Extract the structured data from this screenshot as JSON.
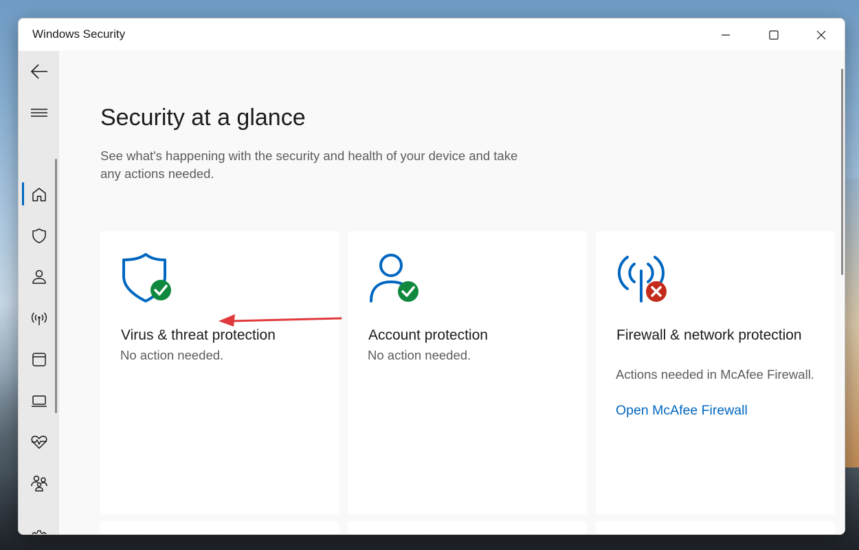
{
  "window": {
    "title": "Windows Security",
    "controls": {
      "minimize": "minimize-icon",
      "maximize": "maximize-icon",
      "close": "close-icon"
    }
  },
  "sidebar": {
    "items": [
      {
        "name": "back",
        "icon": "back-arrow-icon"
      },
      {
        "name": "menu",
        "icon": "hamburger-icon"
      },
      {
        "name": "home",
        "icon": "home-icon",
        "active": true
      },
      {
        "name": "virus-threat-protection",
        "icon": "shield-icon"
      },
      {
        "name": "account-protection",
        "icon": "person-icon"
      },
      {
        "name": "firewall-network",
        "icon": "wireless-icon"
      },
      {
        "name": "app-browser-control",
        "icon": "app-window-icon"
      },
      {
        "name": "device-security",
        "icon": "laptop-icon"
      },
      {
        "name": "device-performance-health",
        "icon": "heart-pulse-icon"
      },
      {
        "name": "family-options",
        "icon": "family-icon"
      },
      {
        "name": "settings",
        "icon": "gear-icon"
      }
    ]
  },
  "main": {
    "title": "Security at a glance",
    "subtitle": "See what's happening with the security and health of your device and take any actions needed.",
    "cards": [
      {
        "title": "Virus & threat protection",
        "status": "No action needed.",
        "icon": "shield-check-icon",
        "state_color": "#10893e"
      },
      {
        "title": "Account protection",
        "status": "No action needed.",
        "icon": "person-check-icon",
        "state_color": "#10893e"
      },
      {
        "title": "Firewall & network protection",
        "status": "Actions needed in McAfee Firewall.",
        "link": "Open McAfee Firewall",
        "icon": "wireless-error-icon",
        "state_color": "#c42b1c"
      }
    ]
  },
  "colors": {
    "accent": "#0067c0",
    "success": "#10893e",
    "error": "#c42b1c",
    "annotation_arrow": "#e0393b"
  }
}
